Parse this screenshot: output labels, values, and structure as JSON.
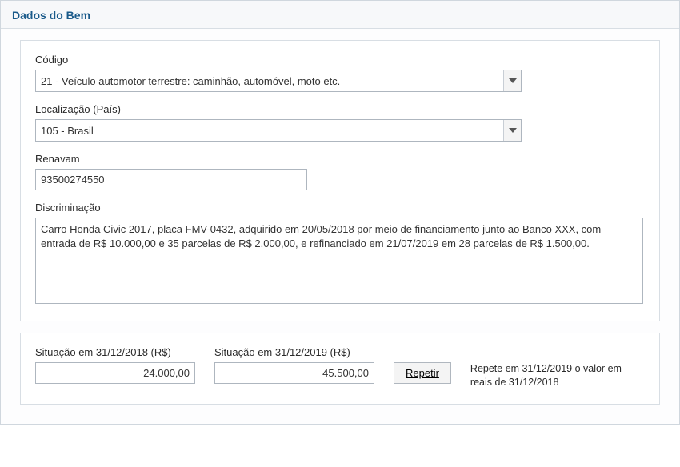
{
  "header": {
    "title": "Dados do Bem"
  },
  "fields": {
    "codigo": {
      "label": "Código",
      "value": "21 - Veículo automotor terrestre: caminhão, automóvel, moto etc."
    },
    "localizacao": {
      "label": "Localização (País)",
      "value": "105 - Brasil"
    },
    "renavam": {
      "label": "Renavam",
      "value": "93500274550"
    },
    "discriminacao": {
      "label": "Discriminação",
      "value": "Carro Honda Civic 2017, placa FMV-0432, adquirido em 20/05/2018 por meio de financiamento junto ao Banco XXX, com entrada de R$ 10.000,00 e 35 parcelas de R$ 2.000,00, e refinanciado em 21/07/2019 em 28 parcelas de R$ 1.500,00."
    }
  },
  "situacao": {
    "y2018": {
      "label": "Situação em 31/12/2018 (R$)",
      "value": "24.000,00"
    },
    "y2019": {
      "label": "Situação em 31/12/2019 (R$)",
      "value": "45.500,00"
    },
    "repetir_label": "Repetir",
    "hint": "Repete em 31/12/2019 o valor em reais de 31/12/2018"
  }
}
